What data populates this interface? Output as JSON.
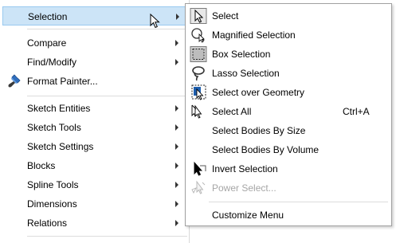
{
  "main_menu": {
    "items": [
      {
        "label": "Selection"
      },
      {
        "label": "Compare"
      },
      {
        "label": "Find/Modify"
      },
      {
        "label": "Format Painter..."
      },
      {
        "label": "Sketch Entities"
      },
      {
        "label": "Sketch Tools"
      },
      {
        "label": "Sketch Settings"
      },
      {
        "label": "Blocks"
      },
      {
        "label": "Spline Tools"
      },
      {
        "label": "Dimensions"
      },
      {
        "label": "Relations"
      }
    ]
  },
  "submenu": {
    "items": [
      {
        "label": "Select",
        "icon": "select-arrow-icon"
      },
      {
        "label": "Magnified Selection",
        "icon": "magnifier-icon"
      },
      {
        "label": "Box Selection",
        "icon": "box-selection-icon"
      },
      {
        "label": "Lasso Selection",
        "icon": "lasso-icon"
      },
      {
        "label": "Select over Geometry",
        "icon": "select-over-geometry-icon"
      },
      {
        "label": "Select All",
        "icon": "select-all-icon",
        "shortcut": "Ctrl+A"
      },
      {
        "label": "Select Bodies By Size"
      },
      {
        "label": "Select Bodies By Volume"
      },
      {
        "label": "Invert Selection",
        "icon": "invert-selection-icon"
      },
      {
        "label": "Power Select...",
        "icon": "power-select-icon",
        "disabled": true
      },
      {
        "label": "Customize Menu"
      }
    ]
  },
  "colors": {
    "highlight_bg": "#cce4f7",
    "highlight_border": "#99c9ef",
    "disabled_text": "#a6a6a6",
    "icon_blue": "#1f5fae"
  }
}
